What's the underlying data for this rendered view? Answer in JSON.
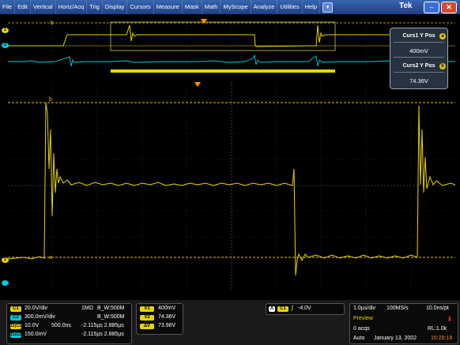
{
  "menubar": {
    "items": [
      "File",
      "Edit",
      "Vertical",
      "Horiz/Acq",
      "Trig",
      "Display",
      "Cursors",
      "Measure",
      "Mask",
      "Math",
      "MyScope",
      "Analyze",
      "Utilities",
      "Help"
    ],
    "dropdown_icon": "chevron-down-icon",
    "brand": "Tek",
    "minimize_icon": "minimize-icon",
    "close_icon": "close-icon"
  },
  "cursor_panel": {
    "curs1_label": "Curs1 Y Pos",
    "curs1_marker": "a",
    "curs1_value": "400mV",
    "curs2_label": "Curs2 Y Pos",
    "curs2_marker": "b",
    "curs2_value": "74.36V"
  },
  "markers": {
    "ch1": "1",
    "ch2": "2",
    "cursor_a": "a",
    "cursor_b": "b",
    "trigger": "T"
  },
  "channels": [
    {
      "badge": "C1",
      "scale": "20.0V/div",
      "impedance": "1MΩ",
      "bw": "B_W:500M",
      "color": "#e6d400"
    },
    {
      "badge": "C2",
      "scale": "300.0mV/div",
      "impedance": "",
      "bw": "B_W:500M",
      "color": "#00c8d8"
    },
    {
      "badge": "Z1(C1)",
      "scale": "10.0V",
      "time": "500.0ns",
      "range": "-2.115µs 2.885µs",
      "color": "#e6d400"
    },
    {
      "badge": "Z1(C2)",
      "scale": "150.0mV",
      "time": "",
      "range": "-2.115µs 2.885µs",
      "color": "#00c8d8"
    }
  ],
  "cursor_readout": {
    "v1_badge": "V1",
    "v1": "400mV",
    "v2_badge": "V2",
    "v2": "74.36V",
    "dv_badge": "ΔV",
    "dv": "73.96V"
  },
  "trigger": {
    "mode_badge": "A",
    "source_badge": "C1",
    "slope_icon": "rising-edge-icon",
    "level": "-4.0V"
  },
  "acquisition": {
    "horiz_scale": "1.0µs/div",
    "sample_rate": "100MS/s",
    "resolution": "10.0ns/pt",
    "mode": "Preview",
    "acqs": "0 acqs",
    "record_length": "RL:1.0k",
    "run_mode": "Auto",
    "date": "January 13, 2002",
    "time": "15:29:19",
    "stop_icon": "red-arrow-icon"
  },
  "colors": {
    "ch1": "#e6d400",
    "ch2": "#00c8d8",
    "menubar": "#2a4f9a",
    "cursor": "#e6c700",
    "stop": "#e0201a",
    "time": "#ff8a00"
  }
}
